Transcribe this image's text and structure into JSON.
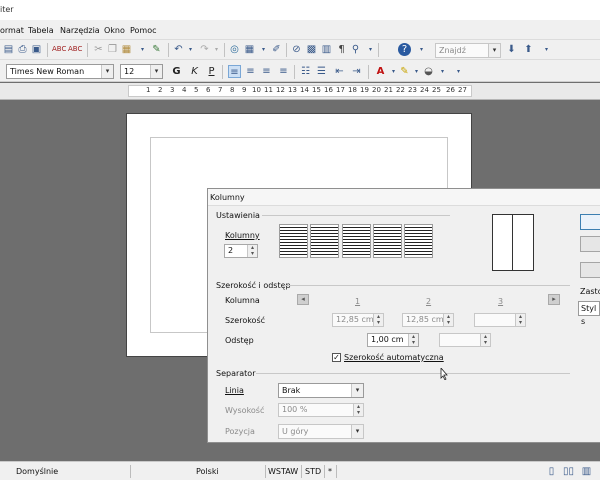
{
  "window": {
    "title_fragment": "iter"
  },
  "menubar": {
    "items": [
      {
        "label": "ormat"
      },
      {
        "label": "Tabela"
      },
      {
        "label": "Narzędzia"
      },
      {
        "label": "Okno"
      },
      {
        "label": "Pomoc"
      }
    ]
  },
  "toolbar": {
    "find_placeholder": "Znajdź",
    "font_name": "Times New Roman",
    "font_size": "12"
  },
  "ruler": {
    "numbers": [
      "1",
      "2",
      "3",
      "4",
      "5",
      "6",
      "7",
      "8",
      "9",
      "10",
      "11",
      "12",
      "13",
      "14",
      "15",
      "16",
      "17",
      "18",
      "19",
      "20",
      "21",
      "22",
      "23",
      "24",
      "25",
      "26",
      "27"
    ]
  },
  "statusbar": {
    "page_style": "Domyślnie",
    "language": "Polski",
    "insert_mode": "WSTAW",
    "selection_mode": "STD",
    "modified": "*"
  },
  "dialog": {
    "title": "Kolumny",
    "settings_section": "Ustawienia",
    "columns_label": "Kolumny",
    "columns_value": "2",
    "width_section": "Szerokość i odstęp",
    "column_label": "Kolumna",
    "column_numbers": [
      "1",
      "2",
      "3"
    ],
    "width_label": "Szerokość",
    "width_values": [
      "12,85 cm",
      "12,85 cm",
      ""
    ],
    "spacing_label": "Odstęp",
    "spacing_value": "1,00 cm",
    "auto_width_label": "Szerokość automatyczna",
    "auto_width_checked": true,
    "separator_section": "Separator",
    "line_label": "Linia",
    "line_value": "Brak",
    "height_label": "Wysokość",
    "height_value": "100 %",
    "position_label": "Pozycja",
    "position_value": "U góry",
    "apply_to_label": "Zasto",
    "apply_to_value": "Styl s"
  }
}
